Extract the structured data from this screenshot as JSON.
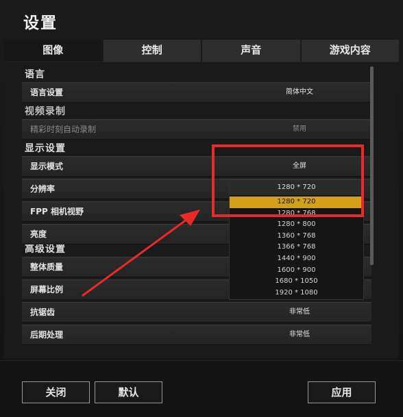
{
  "window": {
    "title": "设置"
  },
  "tabs": [
    {
      "label": "图像",
      "active": true
    },
    {
      "label": "控制",
      "active": false
    },
    {
      "label": "声音",
      "active": false
    },
    {
      "label": "游戏内容",
      "active": false
    }
  ],
  "sections": {
    "language": {
      "title": "语言",
      "rows": [
        {
          "label": "语言设置",
          "value": "简体中文"
        }
      ]
    },
    "video_record": {
      "title": "视频录制",
      "rows": [
        {
          "label": "精彩时刻自动录制",
          "value": "禁用"
        }
      ]
    },
    "display": {
      "title": "显示设置",
      "rows": [
        {
          "label": "显示模式",
          "value": "全屏"
        },
        {
          "label": "分辨率",
          "value": ""
        },
        {
          "label": "FPP 相机视野",
          "value": ""
        },
        {
          "label": "亮度",
          "value": ""
        }
      ]
    },
    "advanced": {
      "title": "高级设置",
      "rows": [
        {
          "label": "整体质量",
          "value": ""
        },
        {
          "label": "屏幕比例",
          "value": ""
        },
        {
          "label": "抗锯齿",
          "value": "非常低"
        },
        {
          "label": "后期处理",
          "value": "非常低"
        }
      ]
    }
  },
  "resolution_dropdown": {
    "current": "1280 * 720",
    "options": [
      "1280 * 720",
      "1280 * 768",
      "1280 * 800",
      "1360 * 768",
      "1366 * 768",
      "1440 * 900",
      "1600 * 900",
      "1680 * 1050",
      "1920 * 1080"
    ],
    "selected_index": 0
  },
  "footer": {
    "close_label": "关闭",
    "default_label": "默认",
    "apply_label": "应用"
  },
  "colors": {
    "accent": "#d4a017",
    "annotation": "#ea2a2a"
  }
}
